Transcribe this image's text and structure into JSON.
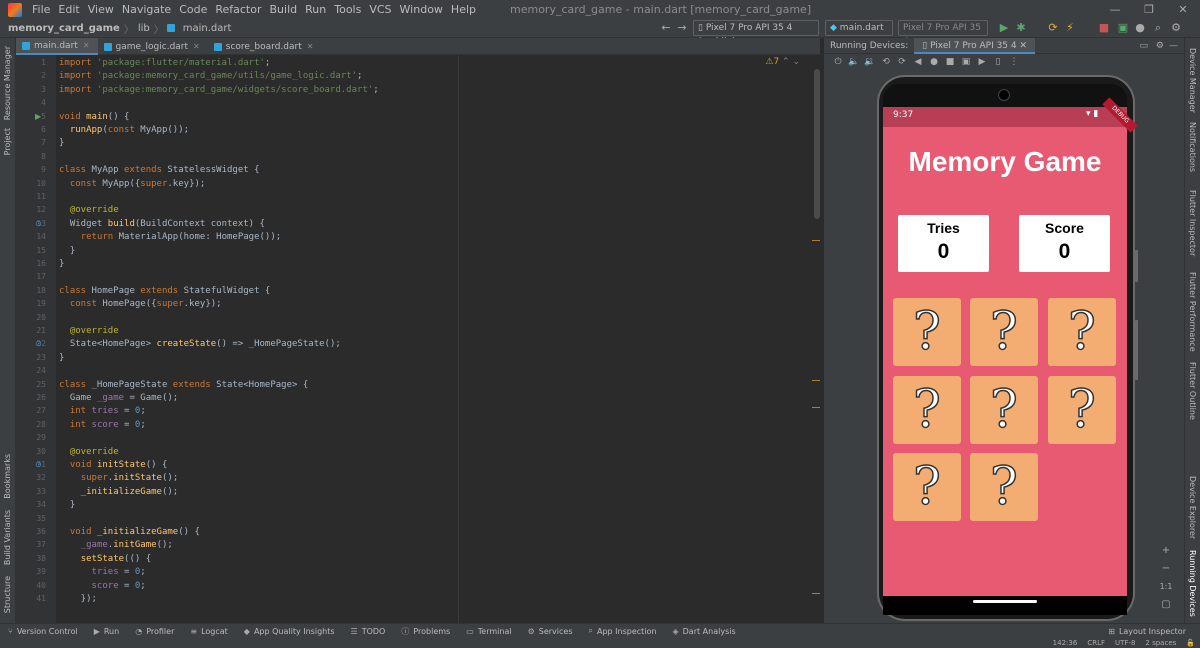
{
  "menu": {
    "items": [
      "File",
      "Edit",
      "View",
      "Navigate",
      "Code",
      "Refactor",
      "Build",
      "Run",
      "Tools",
      "VCS",
      "Window",
      "Help"
    ],
    "window_title": "memory_card_game - main.dart [memory_card_game]"
  },
  "navbar": {
    "breadcrumbs": [
      "memory_card_game",
      "lib",
      "main.dart"
    ],
    "device_selector": "Pixel 7 Pro API 35 4 (mobile)",
    "run_config": "main.dart",
    "device_selector_2": "Pixel 7 Pro API 35 4"
  },
  "left_tools": [
    "Resource Manager",
    "Project",
    "Bookmarks",
    "Build Variants",
    "Structure"
  ],
  "right_tools": [
    "Device Manager",
    "Notifications",
    "Flutter Inspector",
    "Flutter Performance",
    "Flutter Outline",
    "Device Explorer",
    "Running Devices"
  ],
  "editor": {
    "tabs": [
      "main.dart",
      "game_logic.dart",
      "score_board.dart"
    ],
    "warning_count": "7",
    "lines": [
      {
        "n": "1",
        "t": "import 'package:flutter/material.dart';"
      },
      {
        "n": "2",
        "t": "import 'package:memory_card_game/utils/game_logic.dart';"
      },
      {
        "n": "3",
        "t": "import 'package:memory_card_game/widgets/score_board.dart';"
      },
      {
        "n": "4",
        "t": ""
      },
      {
        "n": "5",
        "t": "void main() {"
      },
      {
        "n": "6",
        "t": "  runApp(const MyApp());"
      },
      {
        "n": "7",
        "t": "}"
      },
      {
        "n": "8",
        "t": ""
      },
      {
        "n": "9",
        "t": "class MyApp extends StatelessWidget {"
      },
      {
        "n": "10",
        "t": "  const MyApp({super.key});"
      },
      {
        "n": "11",
        "t": ""
      },
      {
        "n": "12",
        "t": "  @override"
      },
      {
        "n": "13",
        "t": "  Widget build(BuildContext context) {"
      },
      {
        "n": "14",
        "t": "    return MaterialApp(home: HomePage());"
      },
      {
        "n": "15",
        "t": "  }"
      },
      {
        "n": "16",
        "t": "}"
      },
      {
        "n": "17",
        "t": ""
      },
      {
        "n": "18",
        "t": "class HomePage extends StatefulWidget {"
      },
      {
        "n": "19",
        "t": "  const HomePage({super.key});"
      },
      {
        "n": "20",
        "t": ""
      },
      {
        "n": "21",
        "t": "  @override"
      },
      {
        "n": "22",
        "t": "  State<HomePage> createState() => _HomePageState();"
      },
      {
        "n": "23",
        "t": "}"
      },
      {
        "n": "24",
        "t": ""
      },
      {
        "n": "25",
        "t": "class _HomePageState extends State<HomePage> {"
      },
      {
        "n": "26",
        "t": "  Game _game = Game();"
      },
      {
        "n": "27",
        "t": "  int tries = 0;"
      },
      {
        "n": "28",
        "t": "  int score = 0;"
      },
      {
        "n": "29",
        "t": ""
      },
      {
        "n": "30",
        "t": "  @override"
      },
      {
        "n": "31",
        "t": "  void initState() {"
      },
      {
        "n": "32",
        "t": "    super.initState();"
      },
      {
        "n": "33",
        "t": "    _initializeGame();"
      },
      {
        "n": "34",
        "t": "  }"
      },
      {
        "n": "35",
        "t": ""
      },
      {
        "n": "36",
        "t": "  void _initializeGame() {"
      },
      {
        "n": "37",
        "t": "    _game.initGame();"
      },
      {
        "n": "38",
        "t": "    setState(() {"
      },
      {
        "n": "39",
        "t": "      tries = 0;"
      },
      {
        "n": "40",
        "t": "      score = 0;"
      },
      {
        "n": "41",
        "t": "    });"
      }
    ]
  },
  "running_devices": {
    "label": "Running Devices:",
    "tab": "Pixel 7 Pro API 35 4",
    "zoom_label": "1:1"
  },
  "phone": {
    "time": "9:37",
    "debug_label": "DEBUG",
    "app_title": "Memory Game",
    "tries_label": "Tries",
    "tries_value": "0",
    "score_label": "Score",
    "score_value": "0",
    "card_symbol": "?",
    "card_count": 8,
    "colors": {
      "background": "#e85972",
      "card": "#f3ad72"
    }
  },
  "bottom_tools": [
    "Version Control",
    "Run",
    "Profiler",
    "Logcat",
    "App Quality Insights",
    "TODO",
    "Problems",
    "Terminal",
    "Services",
    "App Inspection",
    "Dart Analysis"
  ],
  "layout_inspector": "Layout Inspector",
  "status": {
    "position": "142:36",
    "line_sep": "CRLF",
    "encoding": "UTF-8",
    "indent": "2 spaces"
  }
}
